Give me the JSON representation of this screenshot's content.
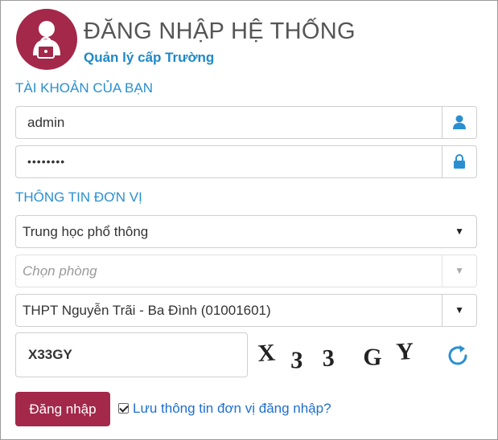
{
  "header": {
    "title": "ĐĂNG NHẬP HỆ THỐNG",
    "subtitle": "Quản lý cấp Trường",
    "logo_icon": "user-lock-icon",
    "brand_color": "#a3284a"
  },
  "account": {
    "section_label": "TÀI KHOẢN CỦA BẠN",
    "username_value": "admin",
    "username_icon": "user-icon",
    "password_value": "••••••••",
    "password_icon": "lock-icon"
  },
  "unit": {
    "section_label": "THÔNG TIN ĐƠN VỊ",
    "level_select": "Trung học phổ thông",
    "office_placeholder": "Chọn phòng",
    "school_select": "THPT Nguyễn Trãi - Ba Đình (01001601)"
  },
  "captcha": {
    "input_value": "X33GY",
    "image_text": "X33GY",
    "refresh_icon": "refresh-icon"
  },
  "actions": {
    "login_label": "Đăng nhập",
    "remember_label": "Lưu thông tin đơn vị đăng nhập?",
    "remember_checked": true
  },
  "colors": {
    "accent": "#2a8fd0",
    "link": "#1e6fd0"
  }
}
